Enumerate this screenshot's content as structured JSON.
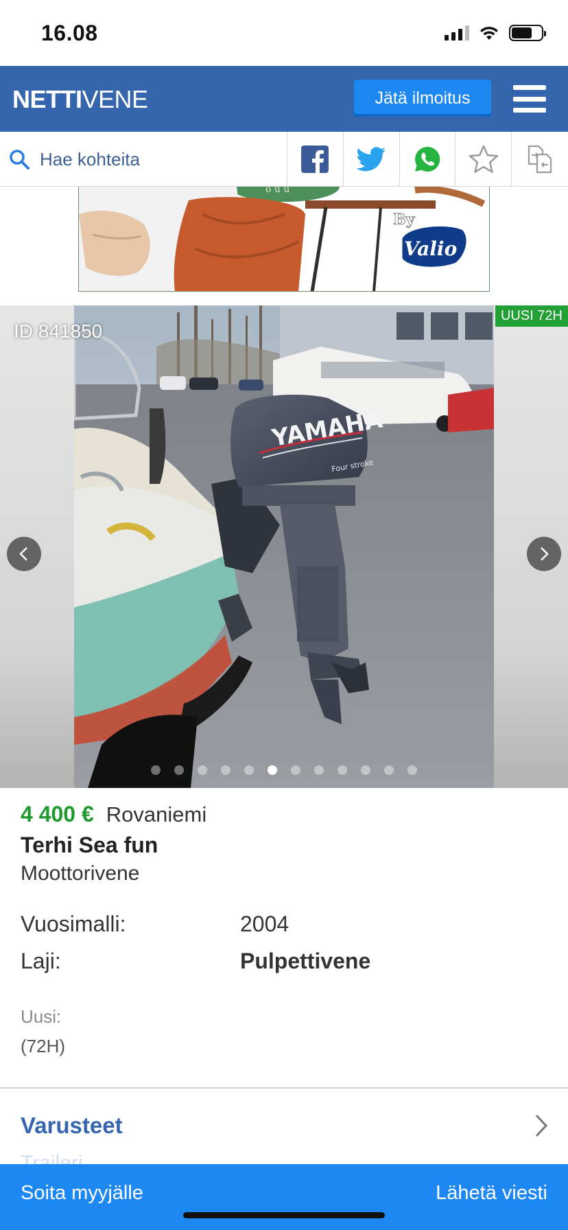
{
  "status_bar": {
    "time": "16.08"
  },
  "nav": {
    "logo_bold": "NETTI",
    "logo_light": "VENE",
    "post_button": "Jätä ilmoitus"
  },
  "toolbar": {
    "search_placeholder": "Hae kohteita",
    "share_icons": [
      "facebook-icon",
      "twitter-icon",
      "whatsapp-icon",
      "star-icon",
      "compare-icon"
    ]
  },
  "ad": {
    "brand_by": "By",
    "brand": "Valio"
  },
  "gallery": {
    "id_label": "ID 841850",
    "badge": "UUSI 72H",
    "motor_brand": "YAMAHA",
    "motor_sub": "Four stroke",
    "image_count": 12,
    "active_index": 5
  },
  "listing": {
    "price": "4 400 €",
    "location": "Rovaniemi",
    "title": "Terhi Sea fun",
    "category": "Moottorivene"
  },
  "specs": [
    {
      "label": "Vuosimalli:",
      "value": "2004"
    },
    {
      "label": "Laji:",
      "value": "Pulpettivene"
    }
  ],
  "condition": {
    "label": "Uusi:",
    "value": "(72H)"
  },
  "equipment": {
    "label": "Varusteet",
    "first_item": "Traileri"
  },
  "actions": {
    "call": "Soita myyjälle",
    "message": "Lähetä viesti"
  },
  "colors": {
    "brand_blue": "#3566ad",
    "action_blue": "#1e88f2",
    "price_green": "#1f9a2e",
    "badge_green": "#20a035"
  }
}
